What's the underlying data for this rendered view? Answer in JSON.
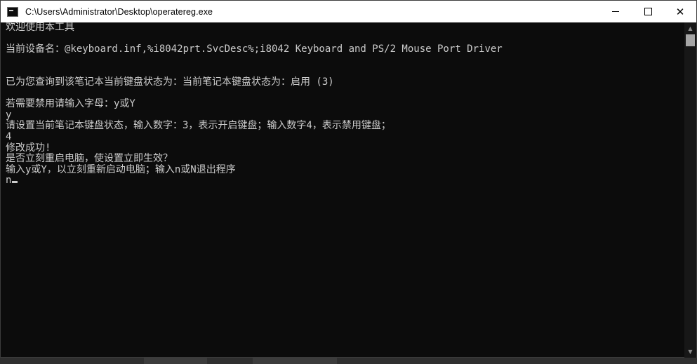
{
  "window": {
    "title": "C:\\Users\\Administrator\\Desktop\\operatereg.exe",
    "controls": {
      "minimize": "minimize",
      "maximize": "maximize",
      "close": "✕"
    }
  },
  "console": {
    "lines": [
      "欢迎使用本工具",
      "",
      "当前设备名：@keyboard.inf,%i8042prt.SvcDesc%;i8042 Keyboard and PS/2 Mouse Port Driver",
      "",
      "",
      "已为您查询到该笔记本当前键盘状态为：当前笔记本键盘状态为：启用 (3)",
      "",
      "若需要禁用请输入字母：y或Y",
      "y",
      "请设置当前笔记本键盘状态，输入数字：3，表示开启键盘；输入数字4，表示禁用键盘；",
      "4",
      "修改成功!",
      "是否立刻重启电脑，使设置立即生效？",
      "输入y或Y，以立刻重新启动电脑；输入n或N退出程序"
    ],
    "input_line": "n"
  },
  "colors": {
    "console_bg": "#0c0c0c",
    "console_fg": "#cccccc",
    "titlebar_bg": "#ffffff"
  },
  "icons": {
    "app": "console-app-icon",
    "scroll_up": "scroll-up-arrow",
    "scroll_down": "scroll-down-arrow"
  }
}
